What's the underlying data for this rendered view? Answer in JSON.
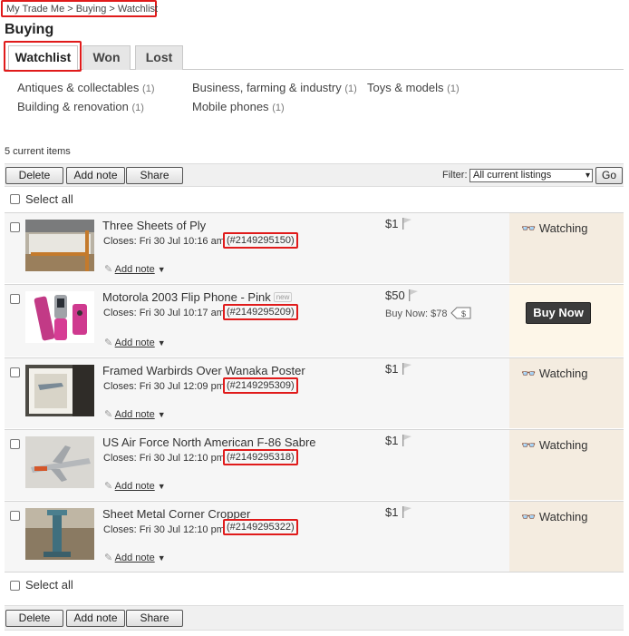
{
  "breadcrumb": "My Trade Me > Buying > Watchlist",
  "page_title": "Buying",
  "tabs": [
    {
      "label": "Watchlist"
    },
    {
      "label": "Won"
    },
    {
      "label": "Lost"
    }
  ],
  "categories": [
    {
      "name": "Antiques & collectables",
      "count": "(1)"
    },
    {
      "name": "Building & renovation",
      "count": "(1)"
    },
    {
      "name": "Business, farming & industry",
      "count": "(1)"
    },
    {
      "name": "Mobile phones",
      "count": "(1)"
    },
    {
      "name": "Toys & models",
      "count": "(1)"
    }
  ],
  "items_count": "5 current items",
  "toolbar": {
    "delete_label": "Delete",
    "add_note_label": "Add note",
    "share_label": "Share",
    "filter_label": "Filter:",
    "filter_value": "All current listings",
    "go_label": "Go"
  },
  "select_all_label": "Select all",
  "listings": [
    {
      "title": "Three Sheets of Ply",
      "closes": "Closes: Fri 30 Jul 10:16 am",
      "listing_id": "(#2149295150)",
      "add_note": "Add note",
      "price": "$1",
      "watching": "Watching"
    },
    {
      "title": "Motorola 2003 Flip Phone - Pink",
      "badge": "new",
      "closes": "Closes: Fri 30 Jul 10:17 am",
      "listing_id": "(#2149295209)",
      "add_note": "Add note",
      "price": "$50",
      "buy_now_price": "Buy Now: $78",
      "buy_now_button": "Buy Now"
    },
    {
      "title": "Framed Warbirds Over Wanaka Poster",
      "closes": "Closes: Fri 30 Jul 12:09 pm",
      "listing_id": "(#2149295309)",
      "add_note": "Add note",
      "price": "$1",
      "watching": "Watching"
    },
    {
      "title": "US Air Force North American F-86 Sabre",
      "closes": "Closes: Fri 30 Jul 12:10 pm",
      "listing_id": "(#2149295318)",
      "add_note": "Add note",
      "price": "$1",
      "watching": "Watching"
    },
    {
      "title": "Sheet Metal Corner Cropper",
      "closes": "Closes: Fri 30 Jul 12:10 pm",
      "listing_id": "(#2149295322)",
      "add_note": "Add note",
      "price": "$1",
      "watching": "Watching"
    }
  ],
  "colors": {
    "highlight_red": "#e01b1b",
    "watching_bg": "#f4ece0",
    "buy_now_bg": "#3c3c3c"
  },
  "icons": [
    "flag-icon",
    "note-icon",
    "chevron-down-icon",
    "binoculars-icon",
    "price-tag-icon"
  ]
}
